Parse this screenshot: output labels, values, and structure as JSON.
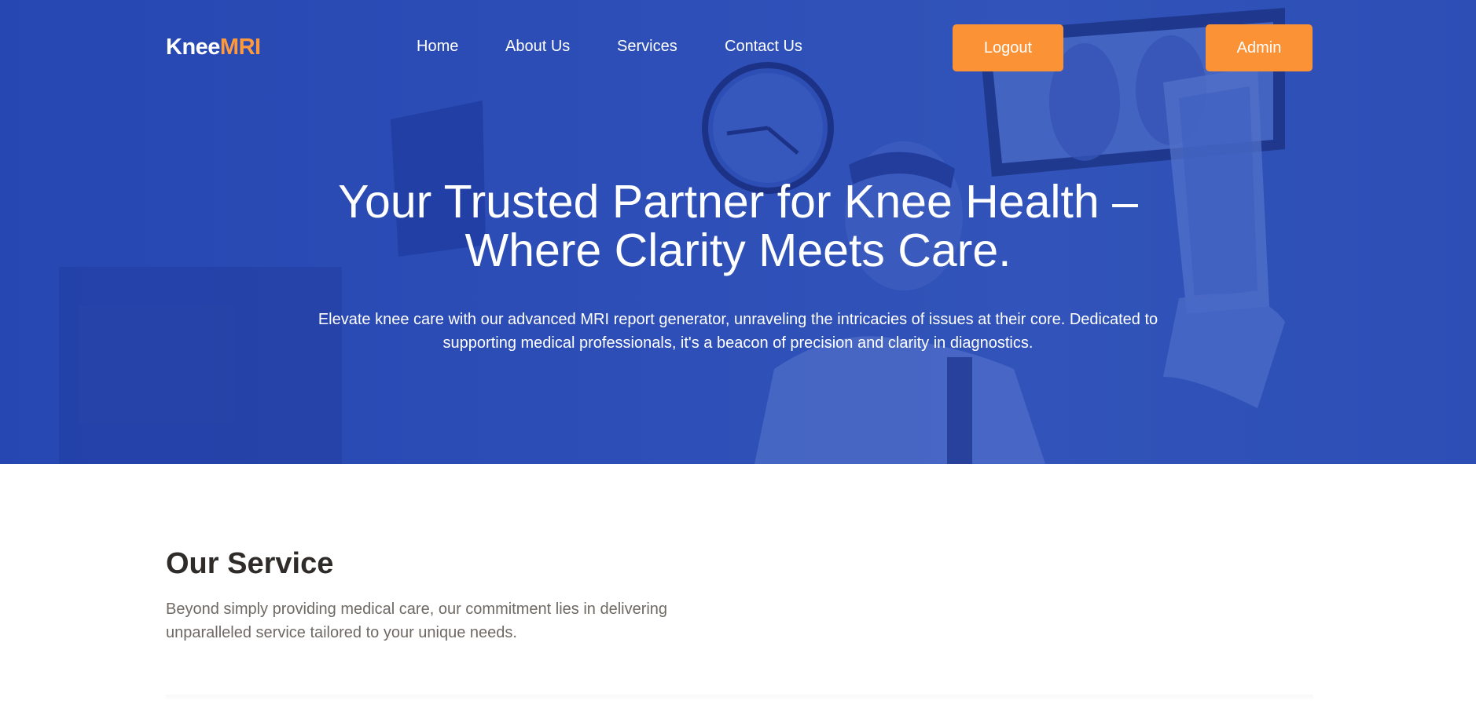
{
  "header": {
    "logo_part1": "Knee",
    "logo_part2": "MRI",
    "nav": [
      "Home",
      "About Us",
      "Services",
      "Contact Us"
    ],
    "logout_label": "Logout",
    "admin_label": "Admin"
  },
  "hero": {
    "title": "Your Trusted Partner for Knee Health – Where Clarity Meets Care.",
    "subtitle": "Elevate knee care with our advanced MRI report generator, unraveling the intricacies of issues at their core. Dedicated to supporting medical professionals, it's a beacon of precision and clarity in diagnostics."
  },
  "service": {
    "title": "Our Service",
    "subtitle": "Beyond simply providing medical care, our commitment lies in delivering unparalleled service tailored to your unique needs."
  },
  "colors": {
    "hero_blue": "#2f50b8",
    "accent_orange": "#fc9236",
    "logo_orange": "#ff9a3c",
    "heading_dark": "#2f2b29",
    "body_gray": "#6f6964"
  },
  "icons": {
    "hero_image": "doctor-reviewing-xray-photo"
  }
}
